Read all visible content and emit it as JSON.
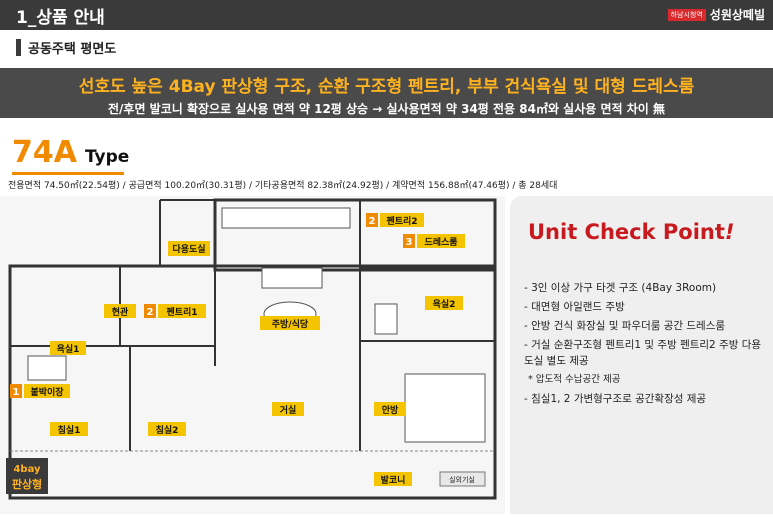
{
  "header": {
    "title": "1_상품 안내",
    "brand_logo_text": "하남시청역",
    "brand_name": "성원상떼빌"
  },
  "section": {
    "title": "공동주택 평면도"
  },
  "banner": {
    "headline": "선호도 높은 4Bay 판상형 구조, 순환 구조형 펜트리, 부부 건식욕실 및 대형 드레스룸",
    "subline": "전/후면 발코니 확장으로 실사용 면적 약 12평 상승 → 실사용면적 약 34평 전용 84㎡와 실사용 면적 차이 無"
  },
  "unit": {
    "code": "74A",
    "type_word": "Type",
    "specs": "전용면적 74.50㎡(22.54평) / 공급면적 100.20㎡(30.31평) / 기타공용면적 82.38㎡(24.92평) / 계약면적 156.88㎡(47.46평) / 총 28세대"
  },
  "plan": {
    "rooms": {
      "utility": "다용도실",
      "pantry2": "펜트리2",
      "dressroom": "드레스룸",
      "entrance": "현관",
      "pantry1": "펜트리1",
      "kitchen": "주방/식당",
      "bath2": "욕실2",
      "bath1": "욕실1",
      "builtin": "붙박이장",
      "bedroom1": "침실1",
      "bedroom2": "침실2",
      "living": "거실",
      "master": "안방",
      "balcony": "발코니",
      "outdoor_unit": "실외기실",
      "bay_label_1": "4bay",
      "bay_label_2": "판상형"
    },
    "badges": {
      "n1": "1",
      "n2": "2",
      "n2b": "2",
      "n3": "3"
    }
  },
  "checkpoint": {
    "title": "Unit Check Point",
    "title_mark": "!",
    "items": [
      "- 3인 이상 가구 타겟 구조 (4Bay 3Room)",
      "- 대면형 아일랜드 주방",
      "- 안방 건식 화장실 및 파우더룸 공간 드레스룸",
      "- 거실 순환구조형 펜트리1 및 주방 펜트리2 주방 다용도실 별도 제공",
      "* 압도적 수납공간 제공",
      "- 침실1, 2 가변형구조로 공간확장성 제공"
    ]
  },
  "colors": {
    "accent_orange": "#f08a00",
    "tag_gold": "#f5c400",
    "title_red": "#c8191e",
    "dark_bar": "#3a3a3a"
  }
}
